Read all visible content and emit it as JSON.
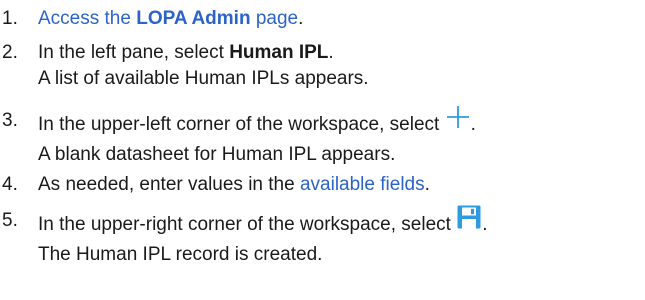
{
  "steps": [
    {
      "number": "1.",
      "pre": "",
      "link": "Access the ",
      "link_bold": "LOPA Admin",
      "link_post": " page",
      "post": "."
    },
    {
      "number": "2.",
      "pre": "In the left pane, select ",
      "bold": "Human IPL",
      "post": ".",
      "result": "A list of available Human IPLs appears."
    },
    {
      "number": "3.",
      "pre": "In the upper-left corner of the workspace, select ",
      "icon": "plus-icon",
      "post": ".",
      "result": "A blank datasheet for Human IPL appears."
    },
    {
      "number": "4.",
      "pre": "As needed, enter values in the ",
      "link": "available fields",
      "post": "."
    },
    {
      "number": "5.",
      "pre": "In the upper-right corner of the workspace, select ",
      "icon": "save-icon",
      "post": ".",
      "result": "The Human IPL record is created."
    }
  ],
  "colors": {
    "link": "#2b63c9",
    "icon": "#2e9be0",
    "text": "#1a1a1a"
  }
}
